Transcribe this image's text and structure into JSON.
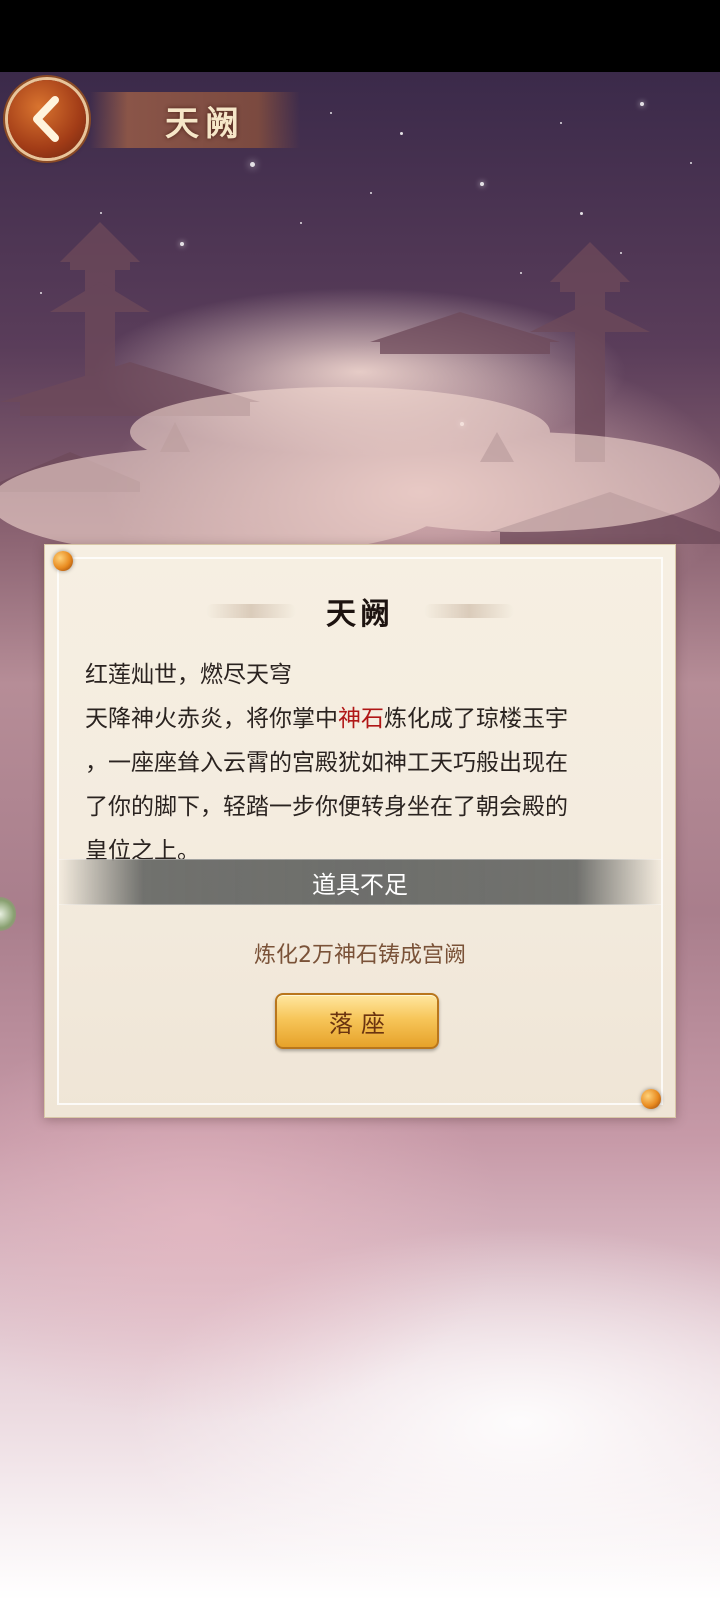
{
  "header": {
    "title": "天阙",
    "back_icon": "chevron-left-icon"
  },
  "panel": {
    "title": "天阙",
    "story_line1": "红莲灿世，燃尽天穹",
    "story_line2_before": "天降神火赤炎，将你掌中",
    "story_line2_highlight": "神石",
    "story_line2_after": "炼化成了琼楼玉宇",
    "story_line3": "，一座座耸入云霄的宫殿犹如神工天巧般出现在",
    "story_line4": "了你的脚下，轻踏一步你便转身坐在了朝会殿的",
    "story_line5": "皇位之上。",
    "toast": "道具不足",
    "cost_text": "炼化2万神石铸成宫阙",
    "sit_button_label": "落座"
  },
  "colors": {
    "highlight": "#b01616",
    "button_gold": "#f7c65a",
    "back_button": "#a23c17"
  }
}
